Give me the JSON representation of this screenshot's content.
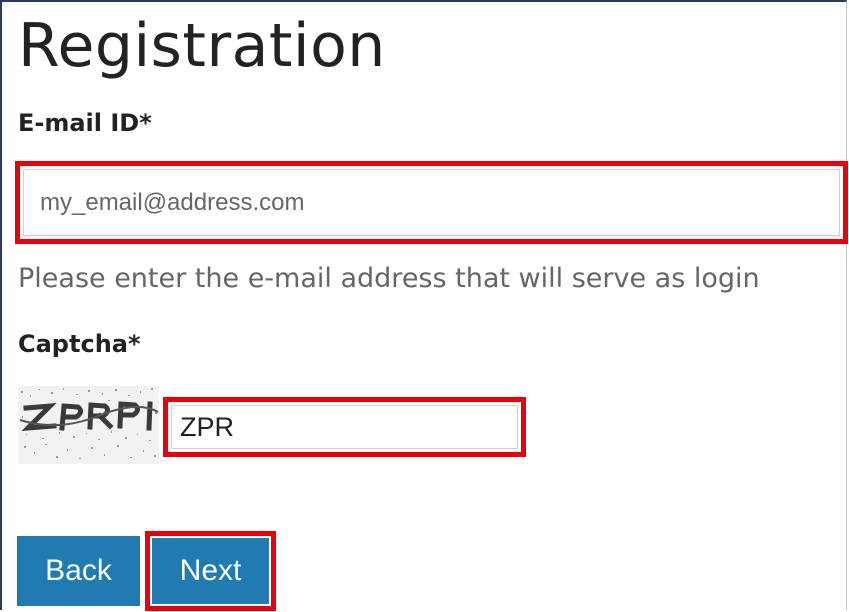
{
  "page": {
    "title": "Registration"
  },
  "email": {
    "label": "E-mail ID*",
    "placeholder": "my_email@address.com",
    "value": "",
    "help": "Please enter the e-mail address that will serve as login"
  },
  "captcha": {
    "label": "Captcha*",
    "value": "ZPR"
  },
  "buttons": {
    "back_label": "Back",
    "next_label": "Next",
    "color": "#1f7bb0"
  },
  "highlight_color": "#e8000b"
}
